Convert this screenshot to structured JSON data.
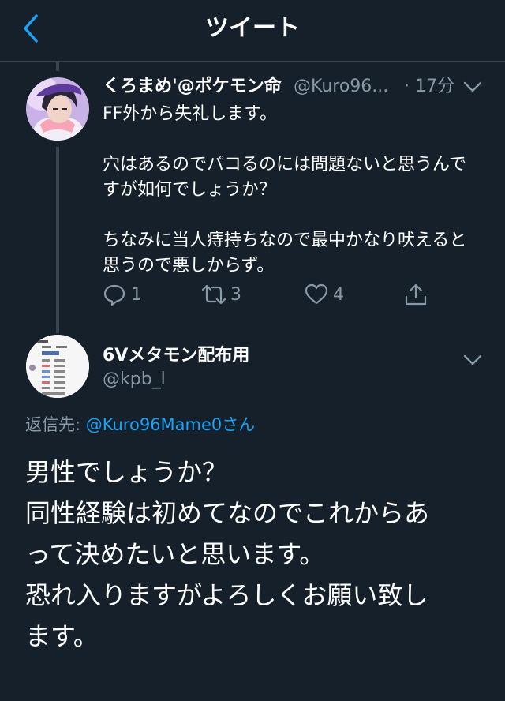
{
  "header": {
    "title": "ツイート",
    "back_icon": "chevron-left-icon",
    "accent": "#1da1f2"
  },
  "parent_tweet": {
    "display_name": "くろまめ'@ポケモン命",
    "handle": "@Kuro96...",
    "time": "· 17分",
    "lines": [
      "FF外から失礼します。",
      "",
      "穴はあるのでパコるのには問題ないと思うんで",
      "すが如何でしょうか？",
      "",
      "ちなみに当人痔持ちなので最中かなり吠えると",
      "思うので悪しからず。"
    ],
    "reply_count": "1",
    "retweet_count": "3",
    "like_count": "4"
  },
  "main_tweet": {
    "display_name": "6Vメタモン配布用",
    "handle": "@kpb_l",
    "reply_to_label": "返信先: ",
    "reply_to_mention": "@Kuro96Mame0さん",
    "lines": [
      "男性でしょうか？",
      "同性経験は初めてなのでこれからあ",
      "って決めたいと思います。",
      "恐れ入りますがよろしくお願い致し",
      "ます。"
    ]
  },
  "colors": {
    "background": "#15202b",
    "secondary_text": "#8899a6",
    "divider": "#38444d"
  }
}
